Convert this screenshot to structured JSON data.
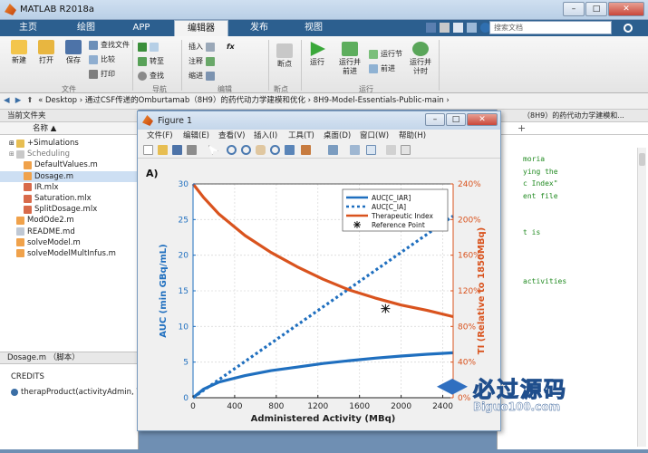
{
  "app": {
    "title": "MATLAB R2018a"
  },
  "tabs": [
    {
      "label": "主页"
    },
    {
      "label": "绘图"
    },
    {
      "label": "APP"
    },
    {
      "label": "编辑器"
    },
    {
      "label": "发布"
    },
    {
      "label": "视图"
    }
  ],
  "search": {
    "placeholder": "搜索文档"
  },
  "ribbon": {
    "file": {
      "new": "新建",
      "open": "打开",
      "save": "保存",
      "find_files": "查找文件",
      "compare": "比较",
      "print": "打印",
      "group": "文件"
    },
    "nav": {
      "goto": "转至",
      "find": "查找",
      "group": "导航"
    },
    "edit": {
      "insert": "插入",
      "comment": "注释",
      "indent": "缩进",
      "fx": "fx",
      "group": "编辑"
    },
    "breakpoints": {
      "breakpoints": "断点",
      "group": "断点"
    },
    "run": {
      "run": "运行",
      "run_advance": "运行并\n前进",
      "run_section": "运行节",
      "advance": "前进",
      "run_time": "运行并\n计时",
      "group": "运行"
    }
  },
  "address": {
    "path": "« Desktop › 通过CSF传递的Omburtamab（8H9）的药代动力学建模和优化 › 8H9-Model-Essentials-Public-main ›"
  },
  "current_folder": {
    "title": "当前文件夹",
    "column": "名称 ▲",
    "items": [
      {
        "name": "+Simulations"
      },
      {
        "name": "Scheduling"
      },
      {
        "name": "DefaultValues.m"
      },
      {
        "name": "Dosage.m"
      },
      {
        "name": "IR.mlx"
      },
      {
        "name": "Saturation.mlx"
      },
      {
        "name": "SplitDosage.mlx"
      },
      {
        "name": "ModOde2.m"
      },
      {
        "name": "README.md"
      },
      {
        "name": "solveModel.m"
      },
      {
        "name": "solveModelMultInfus.m"
      }
    ]
  },
  "details": {
    "file": "Dosage.m  （脚本）",
    "credits": "CREDITS",
    "func": "therapProduct(activityAdmin, V"
  },
  "editor": {
    "tab_title": "（8H9）的药代动力学建模和...",
    "lines": [
      "moria",
      "ying the",
      "c Index\"",
      "ent file",
      "",
      "",
      "t is",
      "",
      "",
      "",
      "activities"
    ]
  },
  "figure": {
    "title": "Figure 1",
    "menu": [
      "文件(F)",
      "编辑(E)",
      "查看(V)",
      "插入(I)",
      "工具(T)",
      "桌面(D)",
      "窗口(W)",
      "帮助(H)"
    ]
  },
  "chart_data": {
    "type": "line",
    "panel_label": "A)",
    "xlabel": "Administered Activity (MBq)",
    "ylabel": "AUC (min GBq/mL)",
    "y2label": "TI (Relative to 1850MBq)",
    "xlim": [
      0,
      2500
    ],
    "ylim": [
      0,
      30
    ],
    "y2lim": [
      0,
      240
    ],
    "xticks": [
      0,
      400,
      800,
      1200,
      1600,
      2000,
      2400
    ],
    "yticks": [
      0,
      5,
      10,
      15,
      20,
      25,
      30
    ],
    "y2ticks": [
      "0%",
      "40%",
      "80%",
      "120%",
      "160%",
      "200%",
      "240%"
    ],
    "grid": true,
    "legend_placement": "top-right",
    "series": [
      {
        "name": "AUC[C_IAR]",
        "axis": "left",
        "color": "#1f6fbf",
        "style": "solid",
        "x": [
          0,
          100,
          250,
          500,
          750,
          1000,
          1250,
          1500,
          1750,
          2000,
          2250,
          2500
        ],
        "y": [
          0,
          1.2,
          2.2,
          3.1,
          3.8,
          4.3,
          4.8,
          5.2,
          5.55,
          5.85,
          6.1,
          6.3
        ]
      },
      {
        "name": "AUC[C_IA]",
        "axis": "left",
        "color": "#1f6fbf",
        "style": "dotted",
        "x": [
          0,
          2500
        ],
        "y": [
          0,
          25.5
        ]
      },
      {
        "name": "Therapeutic Index",
        "axis": "right",
        "color": "#d9531e",
        "style": "solid",
        "x": [
          0,
          100,
          250,
          500,
          750,
          1000,
          1250,
          1500,
          1750,
          2000,
          2250,
          2500
        ],
        "y": [
          240,
          225,
          206,
          182,
          163,
          147,
          133,
          121,
          112,
          104,
          98,
          91
        ]
      }
    ],
    "reference_point": {
      "name": "Reference Point",
      "x": 1850,
      "y2": 100
    },
    "legend": [
      "AUC[C_IAR]",
      "AUC[C_IA]",
      "Therapeutic Index",
      "Reference Point"
    ]
  },
  "watermark": {
    "text": "必过源码",
    "url_text": "Biguo100.com"
  }
}
